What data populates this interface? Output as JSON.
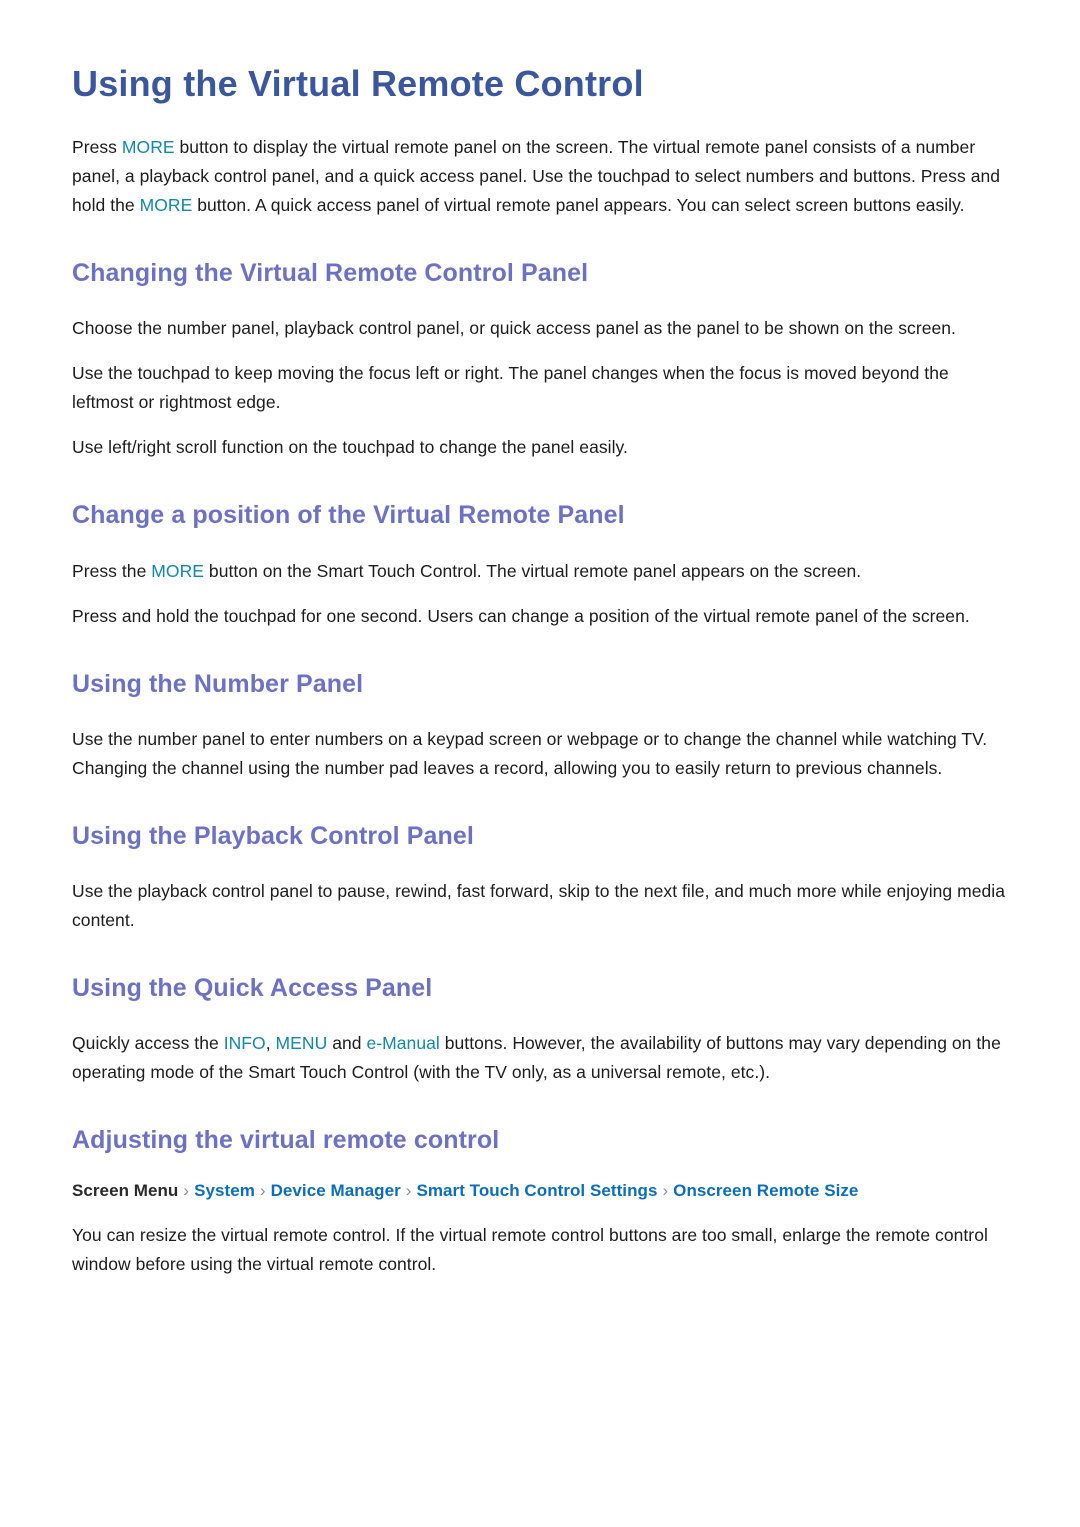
{
  "colors": {
    "title": "#3a579e",
    "heading": "#6d71c6",
    "accent_teal": "#1287a9",
    "breadcrumb_link": "#0c6eb9",
    "breadcrumb_root": "#2a2a2a",
    "body": "#1c1c1c"
  },
  "page_title": "Using the Virtual Remote Control",
  "intro": {
    "p1_a": "Press ",
    "p1_more1": "MORE",
    "p1_b": " button to display the virtual remote panel on the screen. The virtual remote panel consists of a number panel, a playback control panel, and a quick access panel. Use the touchpad to select numbers and buttons. Press and hold the ",
    "p1_more2": "MORE",
    "p1_c": " button. A quick access panel of virtual remote panel appears. You can select screen buttons easily."
  },
  "sections": [
    {
      "heading": "Changing the Virtual Remote Control Panel",
      "paragraphs": [
        "Choose the number panel, playback control panel, or quick access panel as the panel to be shown on the screen.",
        "Use the touchpad to keep moving the focus left or right. The panel changes when the focus is moved beyond the leftmost or rightmost edge.",
        "Use left/right scroll function on the touchpad to change the panel easily."
      ]
    },
    {
      "heading": "Change a position of the Virtual Remote Panel",
      "paragraph_1_a": "Press the ",
      "paragraph_1_more": "MORE",
      "paragraph_1_b": " button on the Smart Touch Control. The virtual remote panel appears on the screen.",
      "paragraph_2": "Press and hold the touchpad for one second. Users can change a position of the virtual remote panel of the screen."
    },
    {
      "heading": "Using the Number Panel",
      "paragraphs": [
        "Use the number panel to enter numbers on a keypad screen or webpage or to change the channel while watching TV. Changing the channel using the number pad leaves a record, allowing you to easily return to previous channels."
      ]
    },
    {
      "heading": "Using the Playback Control Panel",
      "paragraphs": [
        "Use the playback control panel to pause, rewind, fast forward, skip to the next file, and much more while enjoying media content."
      ]
    },
    {
      "heading": "Using the Quick Access Panel",
      "paragraph_a": "Quickly access the ",
      "paragraph_info": "INFO",
      "paragraph_comma": ", ",
      "paragraph_menu": "MENU",
      "paragraph_and": " and ",
      "paragraph_emanual": "e-Manual",
      "paragraph_b": " buttons. However, the availability of buttons may vary depending on the operating mode of the Smart Touch Control (with the TV only, as a universal remote, etc.)."
    },
    {
      "heading": "Adjusting the virtual remote control",
      "breadcrumb": {
        "root": "Screen Menu",
        "separator": "›",
        "items": [
          "System",
          "Device Manager",
          "Smart Touch Control Settings",
          "Onscreen Remote Size"
        ]
      },
      "paragraphs": [
        "You can resize the virtual remote control. If the virtual remote control buttons are too small, enlarge the remote control window before using the virtual remote control."
      ]
    }
  ]
}
